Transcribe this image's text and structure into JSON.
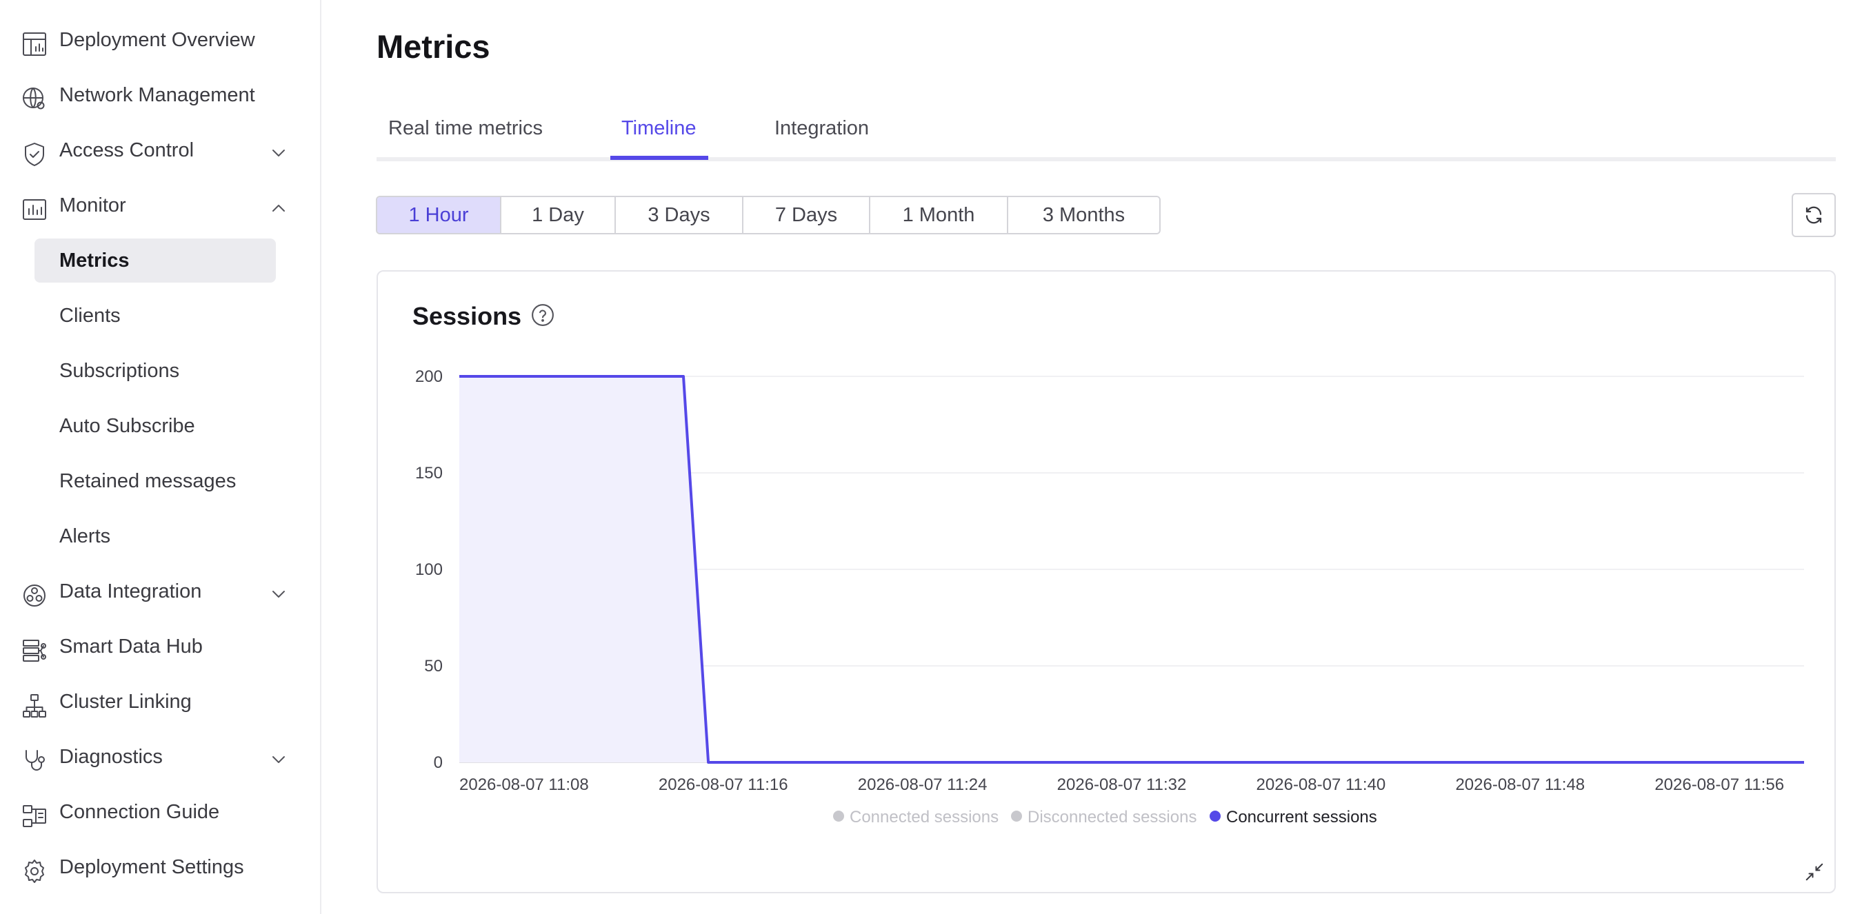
{
  "sidebar": {
    "items": [
      {
        "label": "Deployment Overview",
        "icon": "dashboard-icon",
        "chevron": ""
      },
      {
        "label": "Network Management",
        "icon": "globe-network-icon",
        "chevron": ""
      },
      {
        "label": "Access Control",
        "icon": "shield-check-icon",
        "chevron": "down"
      },
      {
        "label": "Monitor",
        "icon": "monitor-chart-icon",
        "chevron": "up"
      },
      {
        "label": "Data Integration",
        "icon": "data-integration-icon",
        "chevron": "down"
      },
      {
        "label": "Smart Data Hub",
        "icon": "data-hub-icon",
        "chevron": ""
      },
      {
        "label": "Cluster Linking",
        "icon": "cluster-linking-icon",
        "chevron": ""
      },
      {
        "label": "Diagnostics",
        "icon": "stethoscope-icon",
        "chevron": "down"
      },
      {
        "label": "Connection Guide",
        "icon": "connection-guide-icon",
        "chevron": ""
      },
      {
        "label": "Deployment Settings",
        "icon": "gear-icon",
        "chevron": ""
      }
    ],
    "monitor_children": [
      {
        "label": "Metrics",
        "active": true
      },
      {
        "label": "Clients",
        "active": false
      },
      {
        "label": "Subscriptions",
        "active": false
      },
      {
        "label": "Auto Subscribe",
        "active": false
      },
      {
        "label": "Retained messages",
        "active": false
      },
      {
        "label": "Alerts",
        "active": false
      }
    ]
  },
  "page": {
    "title": "Metrics",
    "tabs": [
      {
        "label": "Real time metrics",
        "active": false
      },
      {
        "label": "Timeline",
        "active": true
      },
      {
        "label": "Integration",
        "active": false
      }
    ],
    "ranges": [
      {
        "label": "1 Hour",
        "active": true
      },
      {
        "label": "1 Day",
        "active": false
      },
      {
        "label": "3 Days",
        "active": false
      },
      {
        "label": "7 Days",
        "active": false
      },
      {
        "label": "1 Month",
        "active": false
      },
      {
        "label": "3 Months",
        "active": false
      }
    ],
    "refresh_icon": "refresh-icon"
  },
  "card": {
    "title": "Sessions",
    "help_icon": "question-circle-icon",
    "collapse_icon": "collapse-icon"
  },
  "colors": {
    "accent": "#5548e8",
    "area_fill": "#f1f0fd",
    "legend_inactive": "#c8c8cd",
    "grid": "#ececef"
  },
  "chart_data": {
    "type": "area",
    "title": "Sessions",
    "ylim": [
      0,
      200
    ],
    "yticks": [
      0,
      50,
      100,
      150,
      200
    ],
    "xticks": [
      "2026-08-07 11:08",
      "2026-08-07 11:16",
      "2026-08-07 11:24",
      "2026-08-07 11:32",
      "2026-08-07 11:40",
      "2026-08-07 11:48",
      "2026-08-07 11:56"
    ],
    "xlim": [
      "2026-08-07 11:08",
      "2026-08-07 12:02"
    ],
    "grid": true,
    "legend_position": "bottom",
    "legend": [
      {
        "name": "Connected sessions",
        "active": false
      },
      {
        "name": "Disconnected sessions",
        "active": false
      },
      {
        "name": "Concurrent sessions",
        "active": true
      }
    ],
    "series": [
      {
        "name": "Concurrent sessions",
        "points": [
          [
            "2026-08-07 11:08",
            200
          ],
          [
            "2026-08-07 11:17",
            200
          ],
          [
            "2026-08-07 11:18",
            0
          ],
          [
            "2026-08-07 12:02",
            0
          ]
        ]
      }
    ]
  }
}
